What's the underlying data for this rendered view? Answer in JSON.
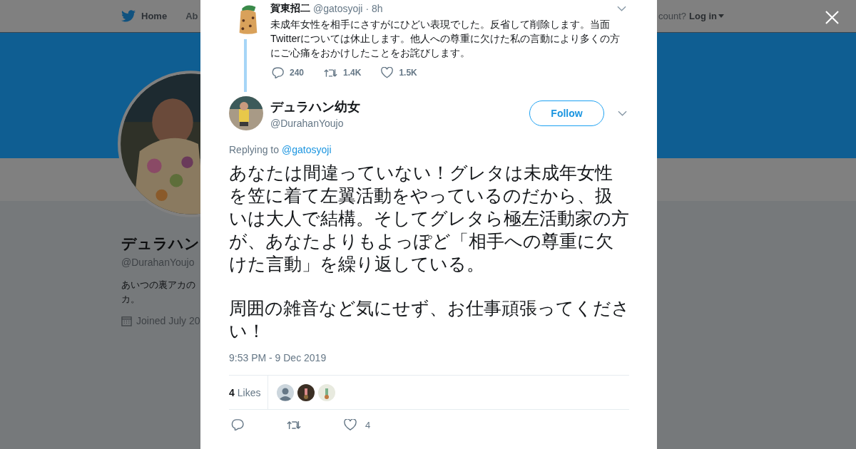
{
  "background": {
    "nav": {
      "items": [
        {
          "label": "Home",
          "selected": true
        },
        {
          "label": "Ab",
          "selected": false
        }
      ],
      "account_prompt": "count?",
      "login": "Log in"
    },
    "profile": {
      "name": "デュラハン",
      "handle": "@DurahanYoujo",
      "bio_lines": [
        "あいつの裏アカの",
        "カ。"
      ],
      "joined": "Joined July 20"
    }
  },
  "modal": {
    "parent_tweet": {
      "name": "賀東招二",
      "handle": "@gatosyoji",
      "time": "· 8h",
      "text": "未成年女性を相手にさすがにひどい表現でした。反省して削除します。当面Twitterについては休止します。他人への尊重に欠けた私の言動により多くの方にご心痛をおかけしたことをお詫びします。",
      "replies": "240",
      "retweets": "1.4K",
      "likes": "1.5K"
    },
    "tweet": {
      "name": "デュラハン幼女",
      "handle": "@DurahanYoujo",
      "follow": "Follow",
      "replying_prefix": "Replying to",
      "replying_handle": "@gatosyoji",
      "paragraphs": [
        "あなたは間違っていない！グレタは未成年女性を笠に着て左翼活動をやっているのだから、扱いは大人で結構。そしてグレタら極左活動家の方が、あなたよりもよっぽど「相手への尊重に欠けた言動」を繰り返している。",
        "周囲の雑音など気にせず、お仕事頑張ってください！"
      ],
      "timestamp": "9:53 PM - 9 Dec 2019",
      "likes_count": "4",
      "likes_label": "Likes",
      "likers": [
        {
          "kind": "default"
        },
        {
          "kind": "picture"
        },
        {
          "kind": "picture"
        }
      ],
      "like_total": "4"
    }
  }
}
